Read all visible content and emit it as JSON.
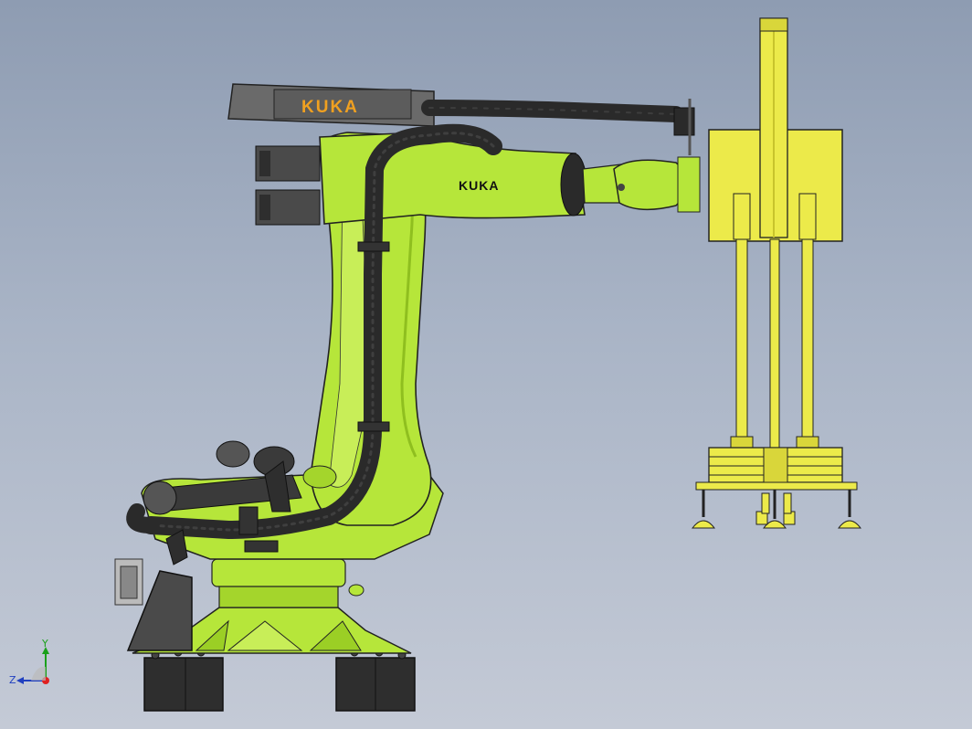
{
  "model": {
    "counterweight_label": "KUKA",
    "arm_label": "KUKA"
  },
  "triad": {
    "y_label": "Y",
    "z_label": "Z"
  },
  "colors": {
    "robot_body": "#b6e63a",
    "robot_shade": "#8fbf1f",
    "gripper": "#ecea4a",
    "gripper_shade": "#c8c42c",
    "cable": "#2a2a2a",
    "counterweight": "#6a6a6a",
    "base_block": "#2e2e2e",
    "logo_orange": "#f0a020"
  }
}
